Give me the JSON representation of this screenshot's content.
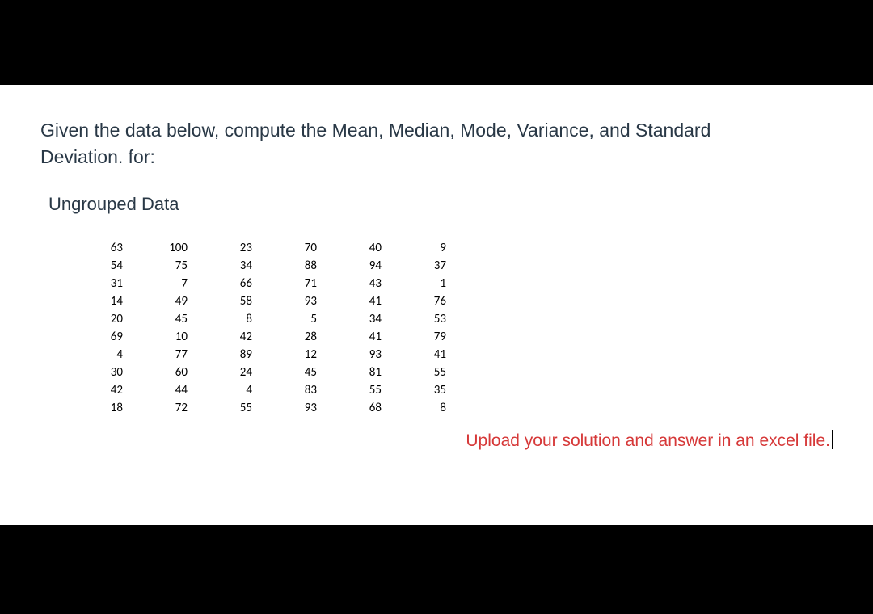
{
  "question_line1": "Given the data below, compute the Mean, Median, Mode, Variance, and Standard",
  "question_line2": "Deviation. for:",
  "section_title": "Ungrouped Data",
  "table": {
    "rows": [
      [
        "63",
        "100",
        "23",
        "70",
        "40",
        "9"
      ],
      [
        "54",
        "75",
        "34",
        "88",
        "94",
        "37"
      ],
      [
        "31",
        "7",
        "66",
        "71",
        "43",
        "1"
      ],
      [
        "14",
        "49",
        "58",
        "93",
        "41",
        "76"
      ],
      [
        "20",
        "45",
        "8",
        "5",
        "34",
        "53"
      ],
      [
        "69",
        "10",
        "42",
        "28",
        "41",
        "79"
      ],
      [
        "4",
        "77",
        "89",
        "12",
        "93",
        "41"
      ],
      [
        "30",
        "60",
        "24",
        "45",
        "81",
        "55"
      ],
      [
        "42",
        "44",
        "4",
        "83",
        "55",
        "35"
      ],
      [
        "18",
        "72",
        "55",
        "93",
        "68",
        "8"
      ]
    ]
  },
  "upload_note": "Upload your solution and answer in an excel file."
}
